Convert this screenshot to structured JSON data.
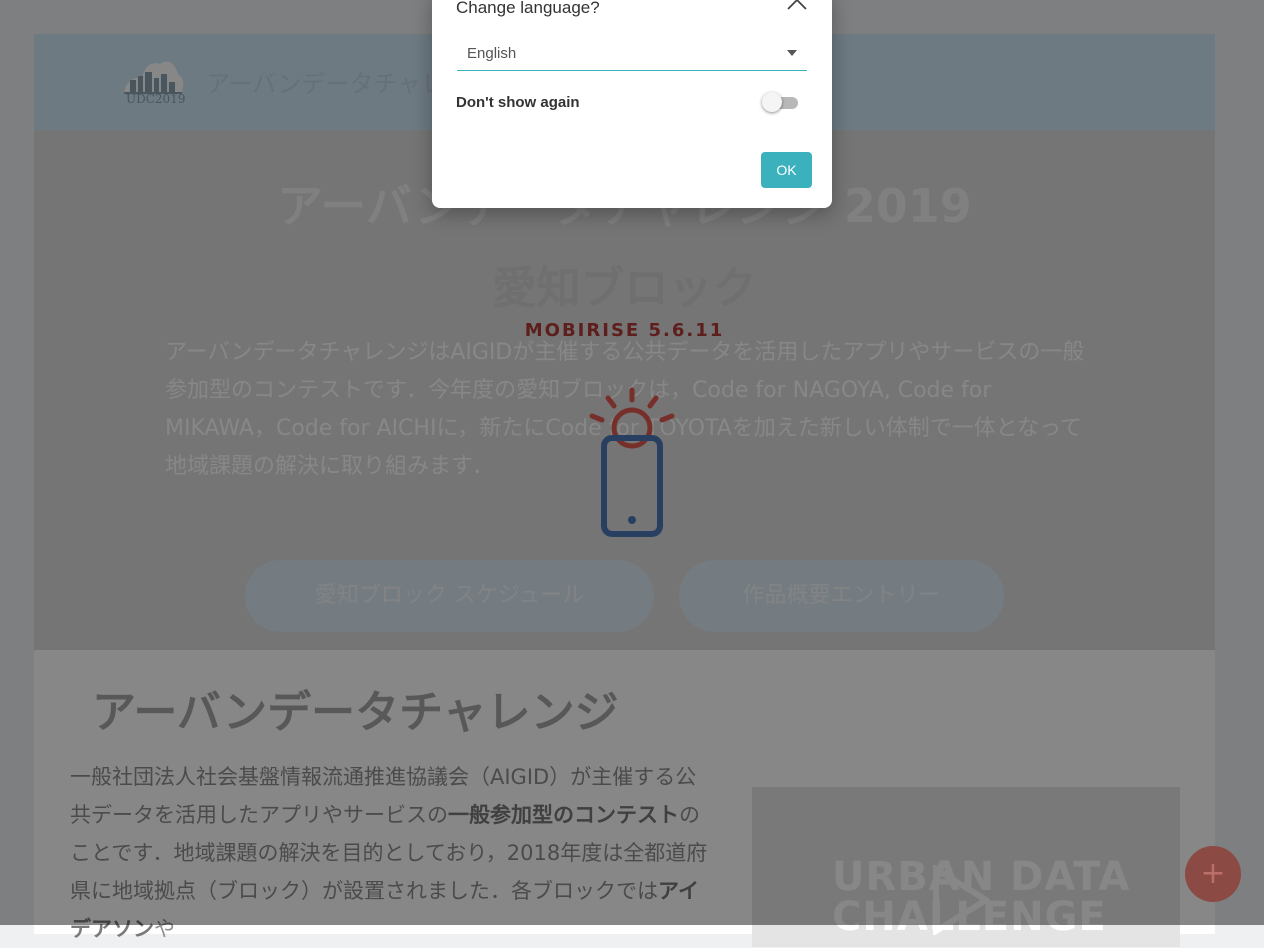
{
  "site": {
    "logo_text": "UDC2019",
    "brand": "アーバンデータチャレンジ"
  },
  "hero": {
    "title": "アーバンデータチャレンジ 2019",
    "subtitle": "愛知ブロック",
    "mobirise": "MOBIRISE  5.6.11",
    "text": "アーバンデータチャレンジはAIGIDが主催する公共データを活用したアプリやサービスの一般参加型のコンテストです．今年度の愛知ブロックは，Code for NAGOYA, Code for MIKAWA，Code for AICHIに，新たにCode for TOYOTAを加えた新しい体制で一体となって地域課題の解決に取り組みます．",
    "button_schedule": "愛知ブロック スケジュール",
    "button_entry": "作品概要エントリー"
  },
  "section": {
    "title": "アーバンデータチャレンジ",
    "text_1": "一般社団法人社会基盤情報流通推進協議会（AIGID）が主催する公共データを活用したアプリやサービスの",
    "text_bold_1": "一般参加型のコンテスト",
    "text_2": "のことです．地域課題の解決を目的としており，2018年度は全都道府県に地域拠点（ブロック）が設置されました．各ブロックでは",
    "text_bold_2": "アイデアソン",
    "text_3": "や",
    "video_text_line1": "URBAN DATA",
    "video_text_line2": "CHALLENGE"
  },
  "fab": {
    "label": "+"
  },
  "dialog": {
    "title": "Change language?",
    "language_selected": "English",
    "dont_show_again_label": "Don't show again",
    "dont_show_again_checked": false,
    "ok_label": "OK"
  },
  "colors": {
    "accent": "#3bb1be",
    "brand_red": "#b03a36",
    "overlay": "rgba(0,0,0,0.47)"
  }
}
